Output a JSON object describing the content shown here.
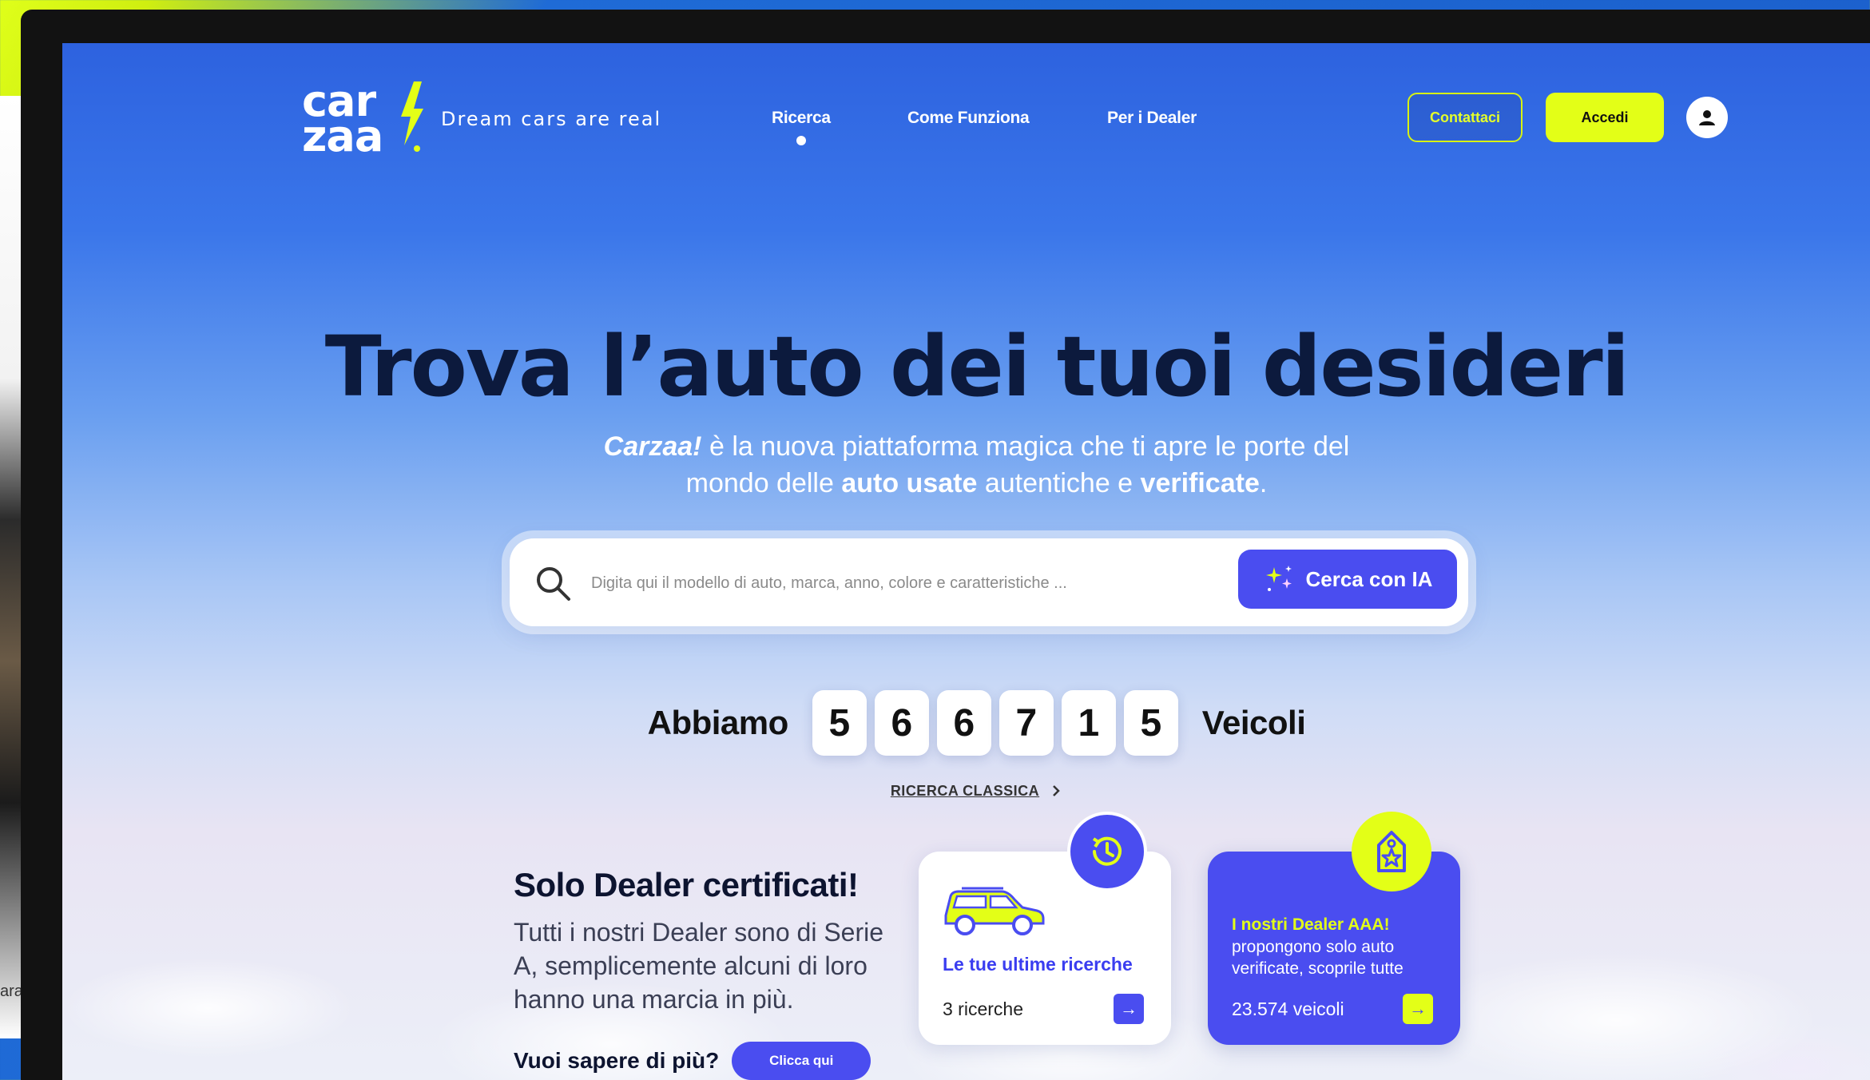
{
  "background": {
    "edge_text": "ara"
  },
  "brand": {
    "logo_line1": "car",
    "logo_line2": "zaa",
    "tagline": "Dream cars are real",
    "accent_color": "#e3ff17",
    "primary_color": "#4a4df0"
  },
  "nav": {
    "items": [
      {
        "label": "Ricerca",
        "active": true
      },
      {
        "label": "Come Funziona",
        "active": false
      },
      {
        "label": "Per i Dealer",
        "active": false
      }
    ],
    "contact_label": "Contattaci",
    "login_label": "Accedi",
    "user_icon": "user-icon"
  },
  "hero": {
    "title": "Trova l’auto dei tuoi desideri",
    "sub_brand": "Carzaa!",
    "sub_part1": " è la nuova piattaforma magica che ti apre le porte del",
    "sub_part2": "mondo delle ",
    "sub_bold1": "auto usate",
    "sub_part3": " autentiche e ",
    "sub_bold2": "verificate",
    "sub_part4": "."
  },
  "search": {
    "placeholder": "Digita qui il modello di auto, marca, anno, colore e caratteristiche ...",
    "value": "",
    "ai_button_label": "Cerca con IA",
    "icon": "search-icon"
  },
  "counter": {
    "prefix": "Abbiamo",
    "digits": [
      "5",
      "6",
      "6",
      "7",
      "1",
      "5"
    ],
    "suffix": "Veicoli"
  },
  "classic_search": {
    "label": "RICERCA CLASSICA"
  },
  "dealer_info": {
    "title": "Solo Dealer certificati!",
    "text": "Tutti i nostri Dealer sono di Serie A, semplicemente alcuni di loro hanno una marcia in più.",
    "learn_more_label": "Vuoi sapere di più?",
    "click_label": "Clicca qui"
  },
  "recent_card": {
    "title": "Le tue ultime ricerche",
    "count": "3 ricerche",
    "badge_icon": "history-icon"
  },
  "dealer_card": {
    "title": "I nostri Dealer AAA!",
    "text": "propongono solo auto verificate, scoprile tutte",
    "count": "23.574 veicoli",
    "badge_icon": "tag-star-icon"
  }
}
